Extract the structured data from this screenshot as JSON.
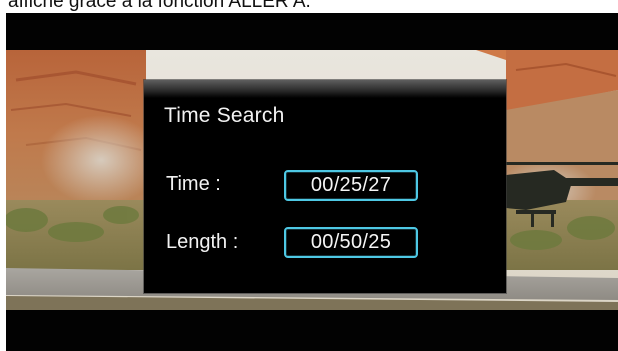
{
  "caption": {
    "text": "affiche grâce à la fonction A​LLER A."
  },
  "dialog": {
    "title": "Time Search",
    "rows": [
      {
        "label": "Time :",
        "value": "00/25/27"
      },
      {
        "label": "Length :",
        "value": "00/50/25"
      }
    ]
  },
  "colors": {
    "field_border": "#4ec8e4",
    "dialog_bg": "#000000",
    "text": "#f2f2f2"
  },
  "icons": []
}
